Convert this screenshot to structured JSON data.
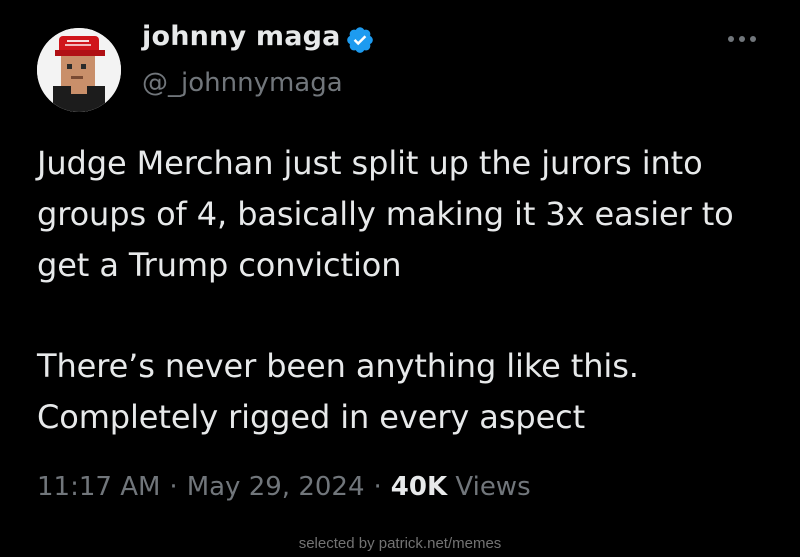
{
  "user": {
    "display_name": "johnny maga",
    "handle": "@_johnnymaga",
    "verified": true,
    "verified_color": "#1d9bf0"
  },
  "tweet": {
    "lines": [
      "Judge Merchan just split up the jurors into",
      "groups of 4, basically making it 3x easier to",
      "get a Trump conviction",
      "There’s never been anything like this.",
      "Completely rigged in every aspect"
    ],
    "time": "11:17 AM",
    "date": "May 29, 2024",
    "views_count": "40K",
    "views_label": "Views"
  },
  "icons": {
    "avatar": "pixel-art-avatar-red-cap",
    "verified": "verified-badge-icon",
    "more": "more-options-icon"
  },
  "watermark": "selected by patrick.net/memes",
  "colors": {
    "background": "#000000",
    "primary_text": "#e7e9ea",
    "secondary_text": "#71767b"
  }
}
